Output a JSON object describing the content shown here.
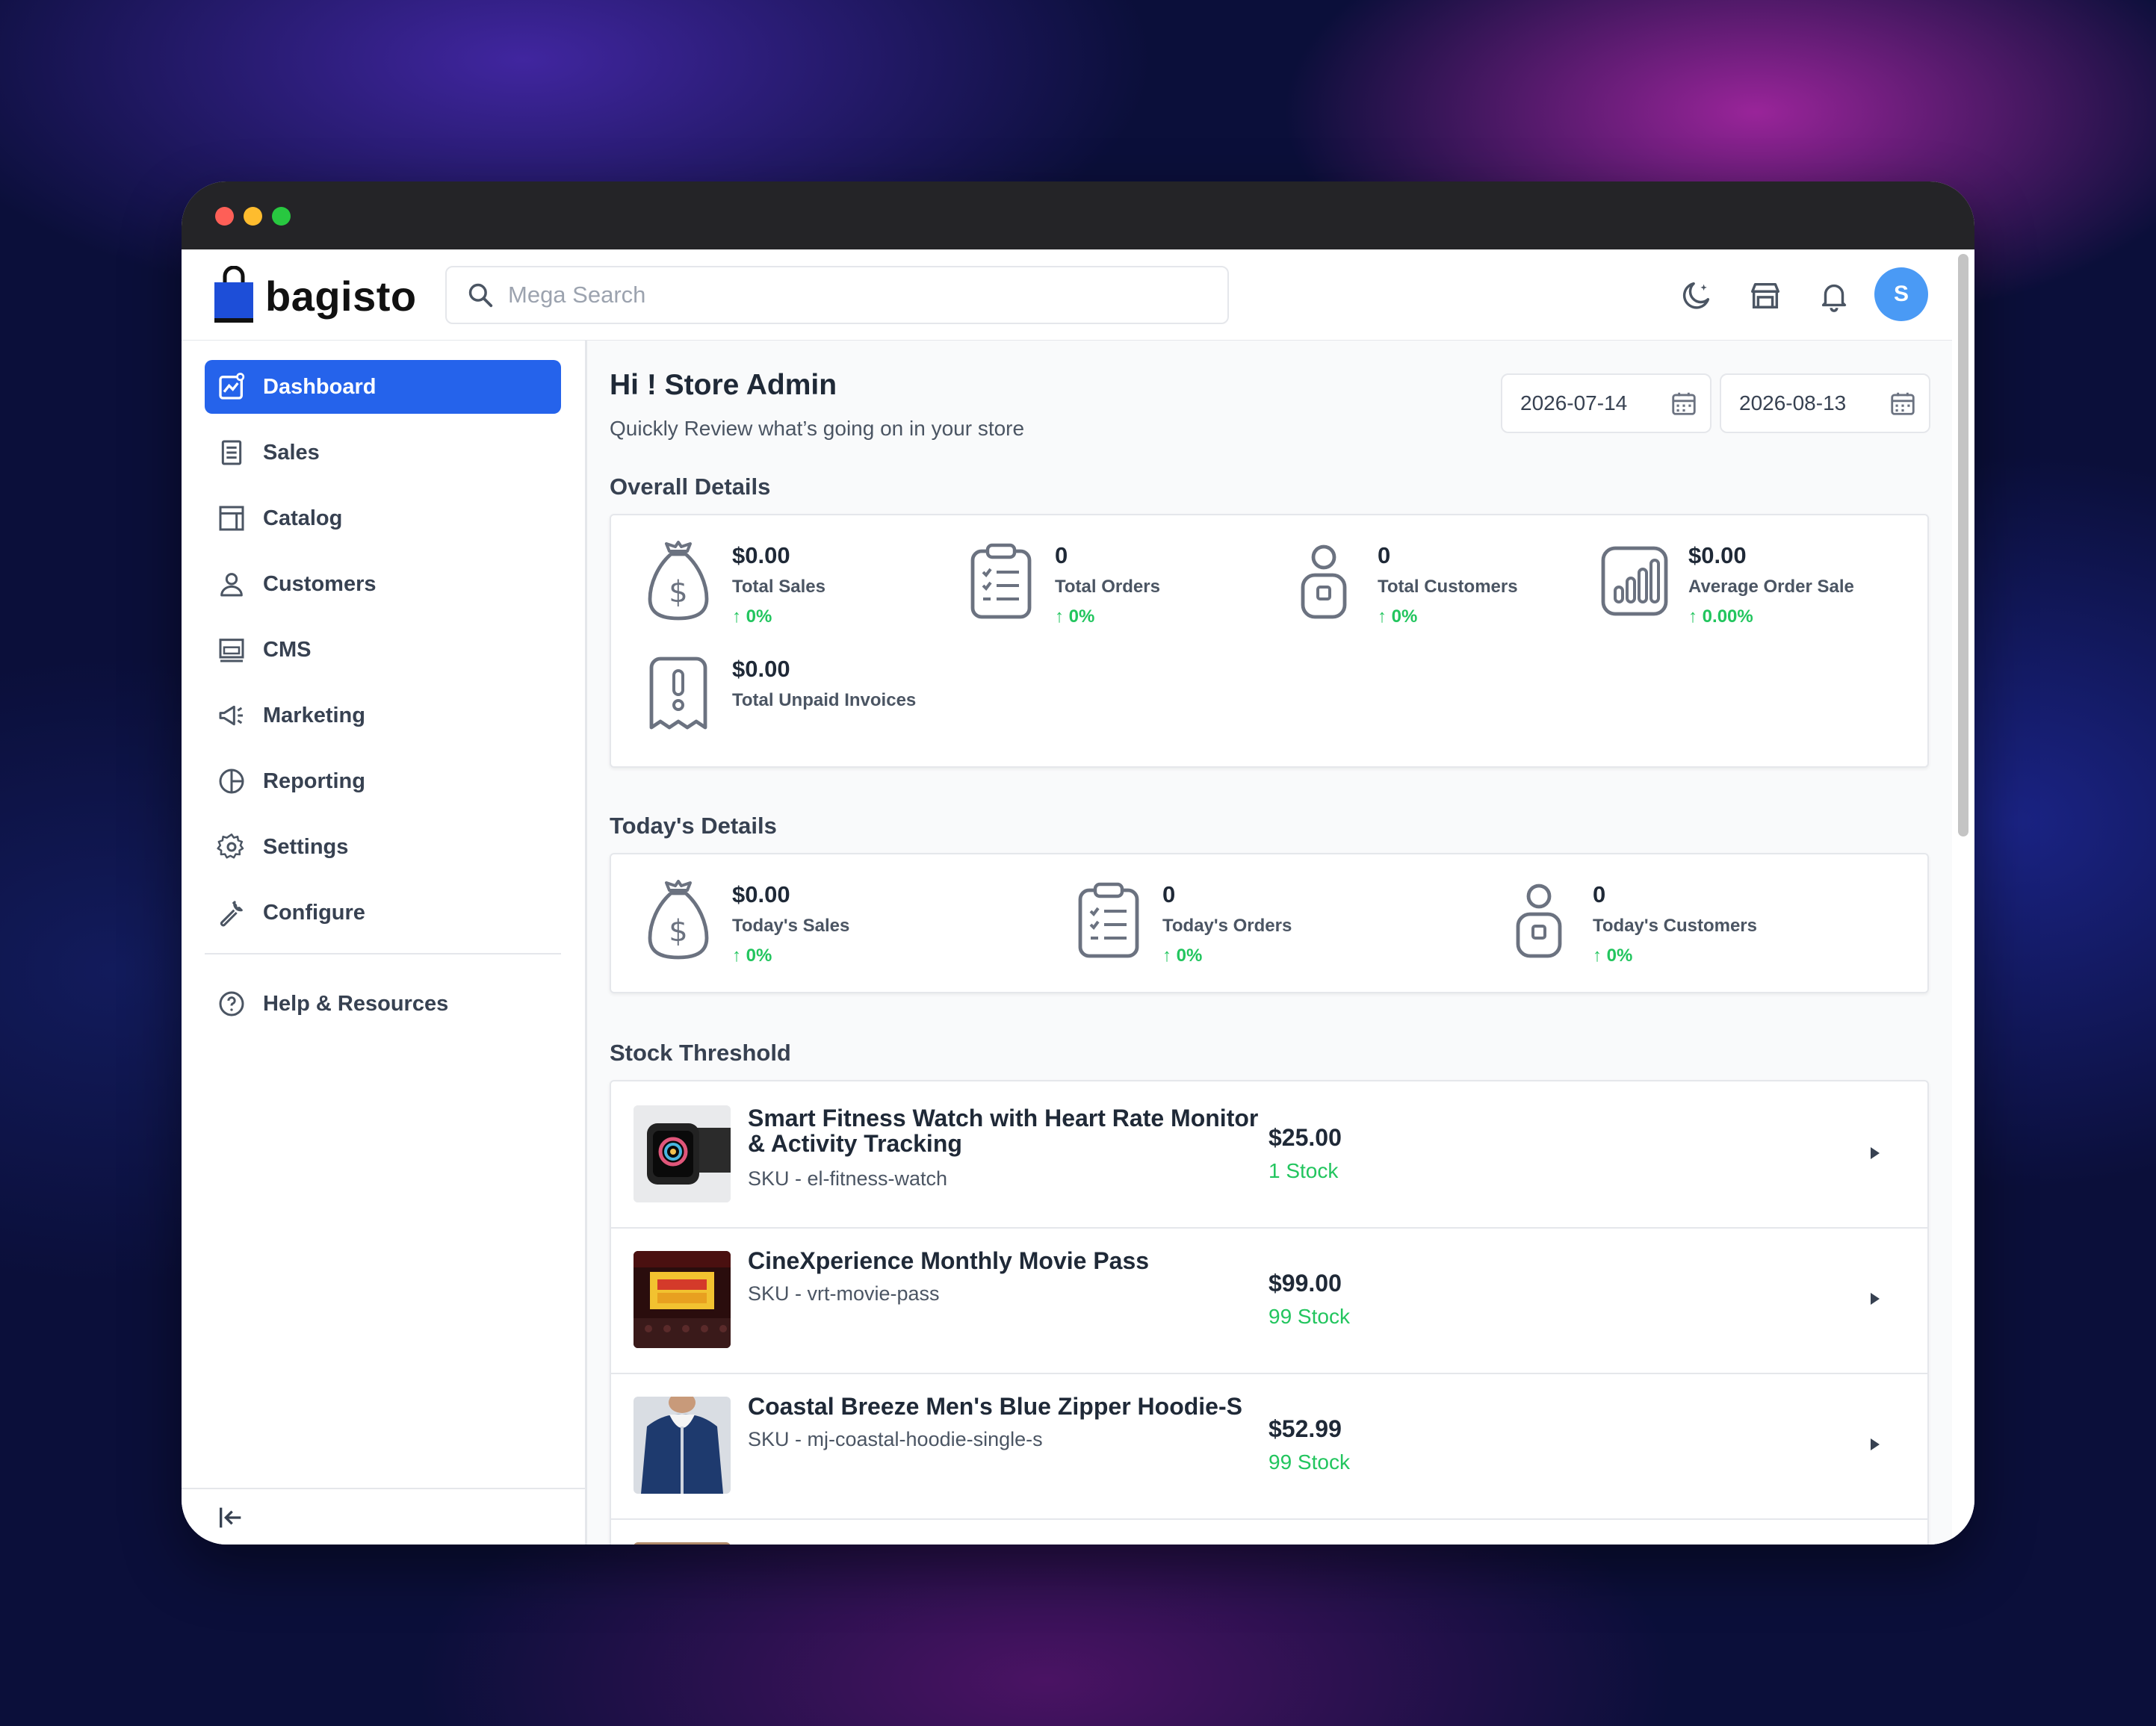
{
  "app": {
    "logo_text": "bagisto",
    "search_placeholder": "Mega Search",
    "avatar_initial": "S"
  },
  "sidebar": {
    "items": [
      {
        "label": "Dashboard",
        "icon": "dashboard-icon",
        "active": true
      },
      {
        "label": "Sales",
        "icon": "sales-icon"
      },
      {
        "label": "Catalog",
        "icon": "catalog-icon"
      },
      {
        "label": "Customers",
        "icon": "customers-icon"
      },
      {
        "label": "CMS",
        "icon": "cms-icon"
      },
      {
        "label": "Marketing",
        "icon": "megaphone-icon"
      },
      {
        "label": "Reporting",
        "icon": "pie-chart-icon"
      },
      {
        "label": "Settings",
        "icon": "gear-icon"
      },
      {
        "label": "Configure",
        "icon": "wrench-icon"
      }
    ],
    "help": {
      "label": "Help & Resources",
      "icon": "help-icon"
    }
  },
  "dashboard": {
    "greeting": "Hi ! Store Admin",
    "subtitle": "Quickly Review what’s going on in your store",
    "date_start": "2026-07-14",
    "date_end": "2026-08-13",
    "overall": {
      "title": "Overall Details",
      "stats": [
        {
          "value": "$0.00",
          "label": "Total Sales",
          "change": "0%",
          "icon": "money-bag-icon"
        },
        {
          "value": "0",
          "label": "Total Orders",
          "change": "0%",
          "icon": "clipboard-list-icon"
        },
        {
          "value": "0",
          "label": "Total Customers",
          "change": "0%",
          "icon": "customer-icon"
        },
        {
          "value": "$0.00",
          "label": "Average Order Sale",
          "change": "0.00%",
          "icon": "bar-chart-icon"
        },
        {
          "value": "$0.00",
          "label": "Total Unpaid Invoices",
          "icon": "invoice-alert-icon"
        }
      ]
    },
    "today": {
      "title": "Today's Details",
      "stats": [
        {
          "value": "$0.00",
          "label": "Today's Sales",
          "change": "0%",
          "icon": "money-bag-icon"
        },
        {
          "value": "0",
          "label": "Today's Orders",
          "change": "0%",
          "icon": "clipboard-list-icon"
        },
        {
          "value": "0",
          "label": "Today's Customers",
          "change": "0%",
          "icon": "customer-icon"
        }
      ]
    },
    "stock": {
      "title": "Stock Threshold",
      "products": [
        {
          "name": "Smart Fitness Watch with Heart Rate Monitor & Activity Tracking",
          "sku": "SKU - el-fitness-watch",
          "price": "$25.00",
          "stock": "1 Stock"
        },
        {
          "name": "CineXperience Monthly Movie Pass",
          "sku": "SKU - vrt-movie-pass",
          "price": "$99.00",
          "stock": "99 Stock"
        },
        {
          "name": "Coastal Breeze Men's Blue Zipper Hoodie-S",
          "sku": "SKU - mj-coastal-hoodie-single-s",
          "price": "$52.99",
          "stock": "99 Stock"
        }
      ]
    }
  },
  "colors": {
    "accent": "#2563eb",
    "positive": "#22c55e",
    "titlebar": "#242427"
  }
}
